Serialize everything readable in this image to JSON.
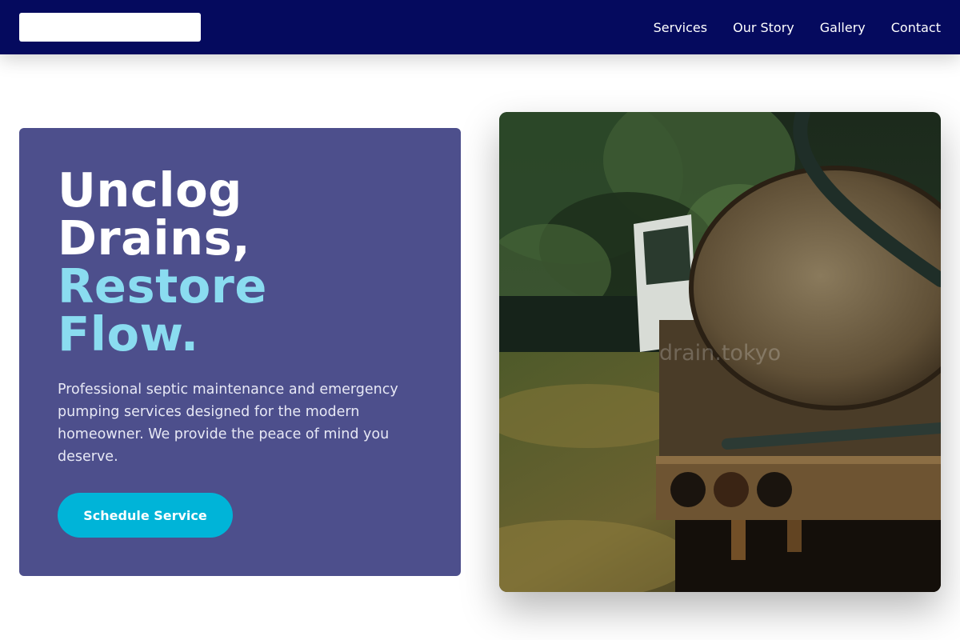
{
  "nav": {
    "links": [
      "Services",
      "Our Story",
      "Gallery",
      "Contact"
    ]
  },
  "hero": {
    "headline_line1": "Unclog",
    "headline_line2": "Drains,",
    "headline_line3": "Restore",
    "headline_line4": "Flow.",
    "description": "Professional septic maintenance and emergency pumping services designed for the modern homeowner. We provide the peace of mind you deserve.",
    "cta_label": "Schedule Service"
  },
  "image": {
    "watermark": "drain.tokyo",
    "subject": "rusted septic tank truck parked under trees"
  },
  "colors": {
    "nav_bg": "#050a5e",
    "card_bg": "#4d4f8c",
    "accent_text": "#8adcf0",
    "cta_bg": "#00b4d8"
  }
}
